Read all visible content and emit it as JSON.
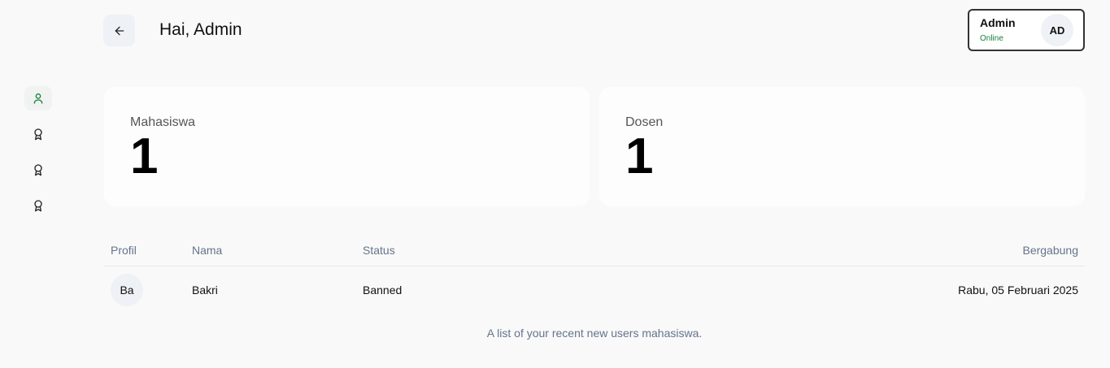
{
  "header": {
    "greeting": "Hai, Admin",
    "back_icon": "arrow-left-icon"
  },
  "user": {
    "name": "Admin",
    "status": "Online",
    "initials": "AD",
    "status_color": "#15803d"
  },
  "sidebar": {
    "items": [
      {
        "icon": "user-icon",
        "active": true
      },
      {
        "icon": "award-icon",
        "active": false
      },
      {
        "icon": "award-icon",
        "active": false
      },
      {
        "icon": "award-icon",
        "active": false
      }
    ],
    "accent": "#15803d"
  },
  "stats": [
    {
      "label": "Mahasiswa",
      "value": "1"
    },
    {
      "label": "Dosen",
      "value": "1"
    }
  ],
  "table": {
    "headers": {
      "profile": "Profil",
      "name": "Nama",
      "status": "Status",
      "joined": "Bergabung"
    },
    "rows": [
      {
        "initials": "Ba",
        "name": "Bakri",
        "status": "Banned",
        "joined": "Rabu, 05 Februari 2025"
      }
    ],
    "caption": "A list of your recent new users mahasiswa."
  }
}
